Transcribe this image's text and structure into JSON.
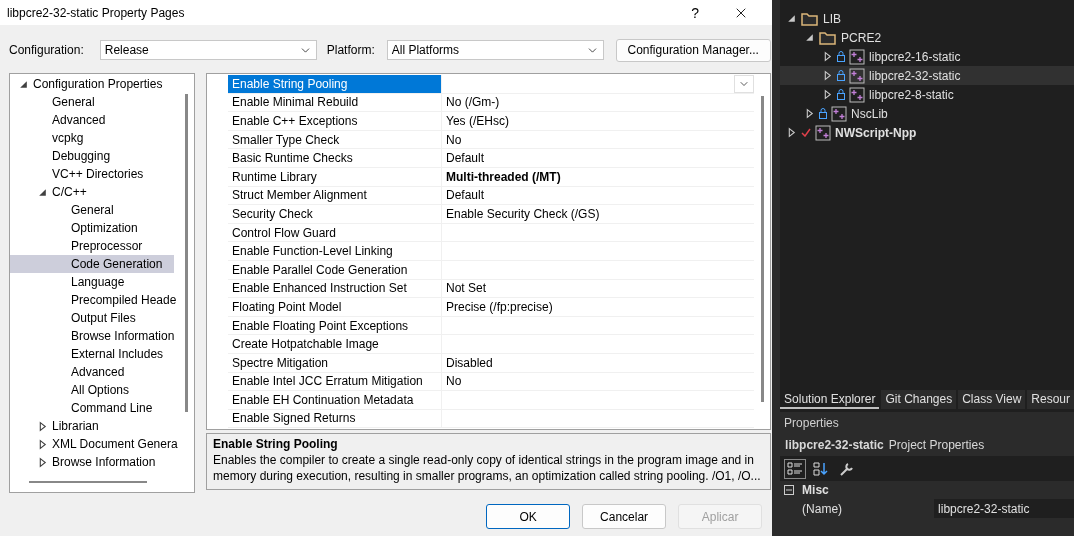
{
  "window": {
    "title": "libpcre2-32-static Property Pages",
    "help": "?"
  },
  "configuration": {
    "label": "Configuration:",
    "value": "Release"
  },
  "platform": {
    "label": "Platform:",
    "value": "All Platforms"
  },
  "config_manager": "Configuration Manager...",
  "tree": [
    {
      "label": "Configuration Properties",
      "expanded": true,
      "selected": false,
      "children": [
        {
          "label": "General",
          "selected": false
        },
        {
          "label": "Advanced",
          "selected": false
        },
        {
          "label": "vcpkg",
          "selected": false
        },
        {
          "label": "Debugging",
          "selected": false
        },
        {
          "label": "VC++ Directories",
          "selected": false
        },
        {
          "label": "C/C++",
          "expanded": true,
          "selected": false,
          "children": [
            {
              "label": "General",
              "selected": false
            },
            {
              "label": "Optimization",
              "selected": false
            },
            {
              "label": "Preprocessor",
              "selected": false
            },
            {
              "label": "Code Generation",
              "selected": true
            },
            {
              "label": "Language",
              "selected": false
            },
            {
              "label": "Precompiled Heade",
              "selected": false
            },
            {
              "label": "Output Files",
              "selected": false
            },
            {
              "label": "Browse Information",
              "selected": false
            },
            {
              "label": "External Includes",
              "selected": false
            },
            {
              "label": "Advanced",
              "selected": false
            },
            {
              "label": "All Options",
              "selected": false
            },
            {
              "label": "Command Line",
              "selected": false
            }
          ]
        },
        {
          "label": "Librarian",
          "expanded": false,
          "selected": false
        },
        {
          "label": "XML Document Genera",
          "expanded": false,
          "selected": false
        },
        {
          "label": "Browse Information",
          "expanded": false,
          "selected": false
        }
      ]
    }
  ],
  "properties": [
    {
      "name": "Enable String Pooling",
      "selected": true,
      "bold": false
    },
    {
      "name": "Enable Minimal Rebuild",
      "value": "No (/Gm-)",
      "selected": false,
      "bold": false
    },
    {
      "name": "Enable C++ Exceptions",
      "value": "Yes (/EHsc)",
      "selected": false,
      "bold": false
    },
    {
      "name": "Smaller Type Check",
      "value": "No",
      "selected": false,
      "bold": false
    },
    {
      "name": "Basic Runtime Checks",
      "value": "Default",
      "selected": false,
      "bold": false
    },
    {
      "name": "Runtime Library",
      "value": "Multi-threaded (/MT)",
      "selected": false,
      "bold": true
    },
    {
      "name": "Struct Member Alignment",
      "value": "Default",
      "selected": false,
      "bold": false
    },
    {
      "name": "Security Check",
      "value": "Enable Security Check (/GS)",
      "selected": false,
      "bold": false
    },
    {
      "name": "Control Flow Guard",
      "selected": false,
      "bold": false
    },
    {
      "name": "Enable Function-Level Linking",
      "selected": false,
      "bold": false
    },
    {
      "name": "Enable Parallel Code Generation",
      "selected": false,
      "bold": false
    },
    {
      "name": "Enable Enhanced Instruction Set",
      "value": "Not Set",
      "selected": false,
      "bold": false
    },
    {
      "name": "Floating Point Model",
      "value": "Precise (/fp:precise)",
      "selected": false,
      "bold": false
    },
    {
      "name": "Enable Floating Point Exceptions",
      "selected": false,
      "bold": false
    },
    {
      "name": "Create Hotpatchable Image",
      "selected": false,
      "bold": false
    },
    {
      "name": "Spectre Mitigation",
      "value": "Disabled",
      "selected": false,
      "bold": false
    },
    {
      "name": "Enable Intel JCC Erratum Mitigation",
      "value": "No",
      "selected": false,
      "bold": false
    },
    {
      "name": "Enable EH Continuation Metadata",
      "selected": false,
      "bold": false
    },
    {
      "name": "Enable Signed Returns",
      "selected": false,
      "bold": false
    }
  ],
  "description": {
    "title": "Enable String Pooling",
    "text": "Enables the compiler to create a single read-only copy of identical strings in the program image and in memory during execution, resulting in smaller programs, an optimization called string pooling. /O1, /O..."
  },
  "buttons": [
    {
      "label": "OK",
      "kind": "default"
    },
    {
      "label": "Cancelar",
      "kind": "normal"
    },
    {
      "label": "Aplicar",
      "kind": "disabled"
    }
  ],
  "solution": [
    {
      "label": "LIB",
      "kind": "folder",
      "expanded": true,
      "selected": false,
      "bold": false,
      "locked": false,
      "checked": false,
      "children": [
        {
          "label": "PCRE2",
          "kind": "folder",
          "expanded": true,
          "selected": false,
          "bold": false,
          "locked": false,
          "checked": false,
          "children": [
            {
              "label": "libpcre2-16-static",
              "kind": "project",
              "expanded": false,
              "selected": false,
              "bold": false,
              "locked": true,
              "checked": false
            },
            {
              "label": "libpcre2-32-static",
              "kind": "project",
              "expanded": false,
              "selected": true,
              "bold": false,
              "locked": true,
              "checked": false
            },
            {
              "label": "libpcre2-8-static",
              "kind": "project",
              "expanded": false,
              "selected": false,
              "bold": false,
              "locked": true,
              "checked": false
            }
          ]
        },
        {
          "label": "NscLib",
          "kind": "project",
          "expanded": false,
          "selected": false,
          "bold": false,
          "locked": true,
          "checked": false
        }
      ]
    },
    {
      "label": "NWScript-Npp",
      "kind": "project",
      "expanded": false,
      "selected": false,
      "bold": true,
      "locked": false,
      "checked": true
    }
  ],
  "tabs": [
    {
      "label": "Solution Explorer",
      "selected": true
    },
    {
      "label": "Git Changes",
      "selected": false
    },
    {
      "label": "Class View",
      "selected": false
    },
    {
      "label": "Resour",
      "selected": false
    }
  ],
  "props_panel": {
    "title": "Properties",
    "object": "libpcre2-32-static",
    "object_type": "Project Properties",
    "section": {
      "label": "Misc",
      "expanded": true
    },
    "rows": [
      {
        "name": "(Name)",
        "value": "libpcre2-32-static"
      }
    ]
  }
}
